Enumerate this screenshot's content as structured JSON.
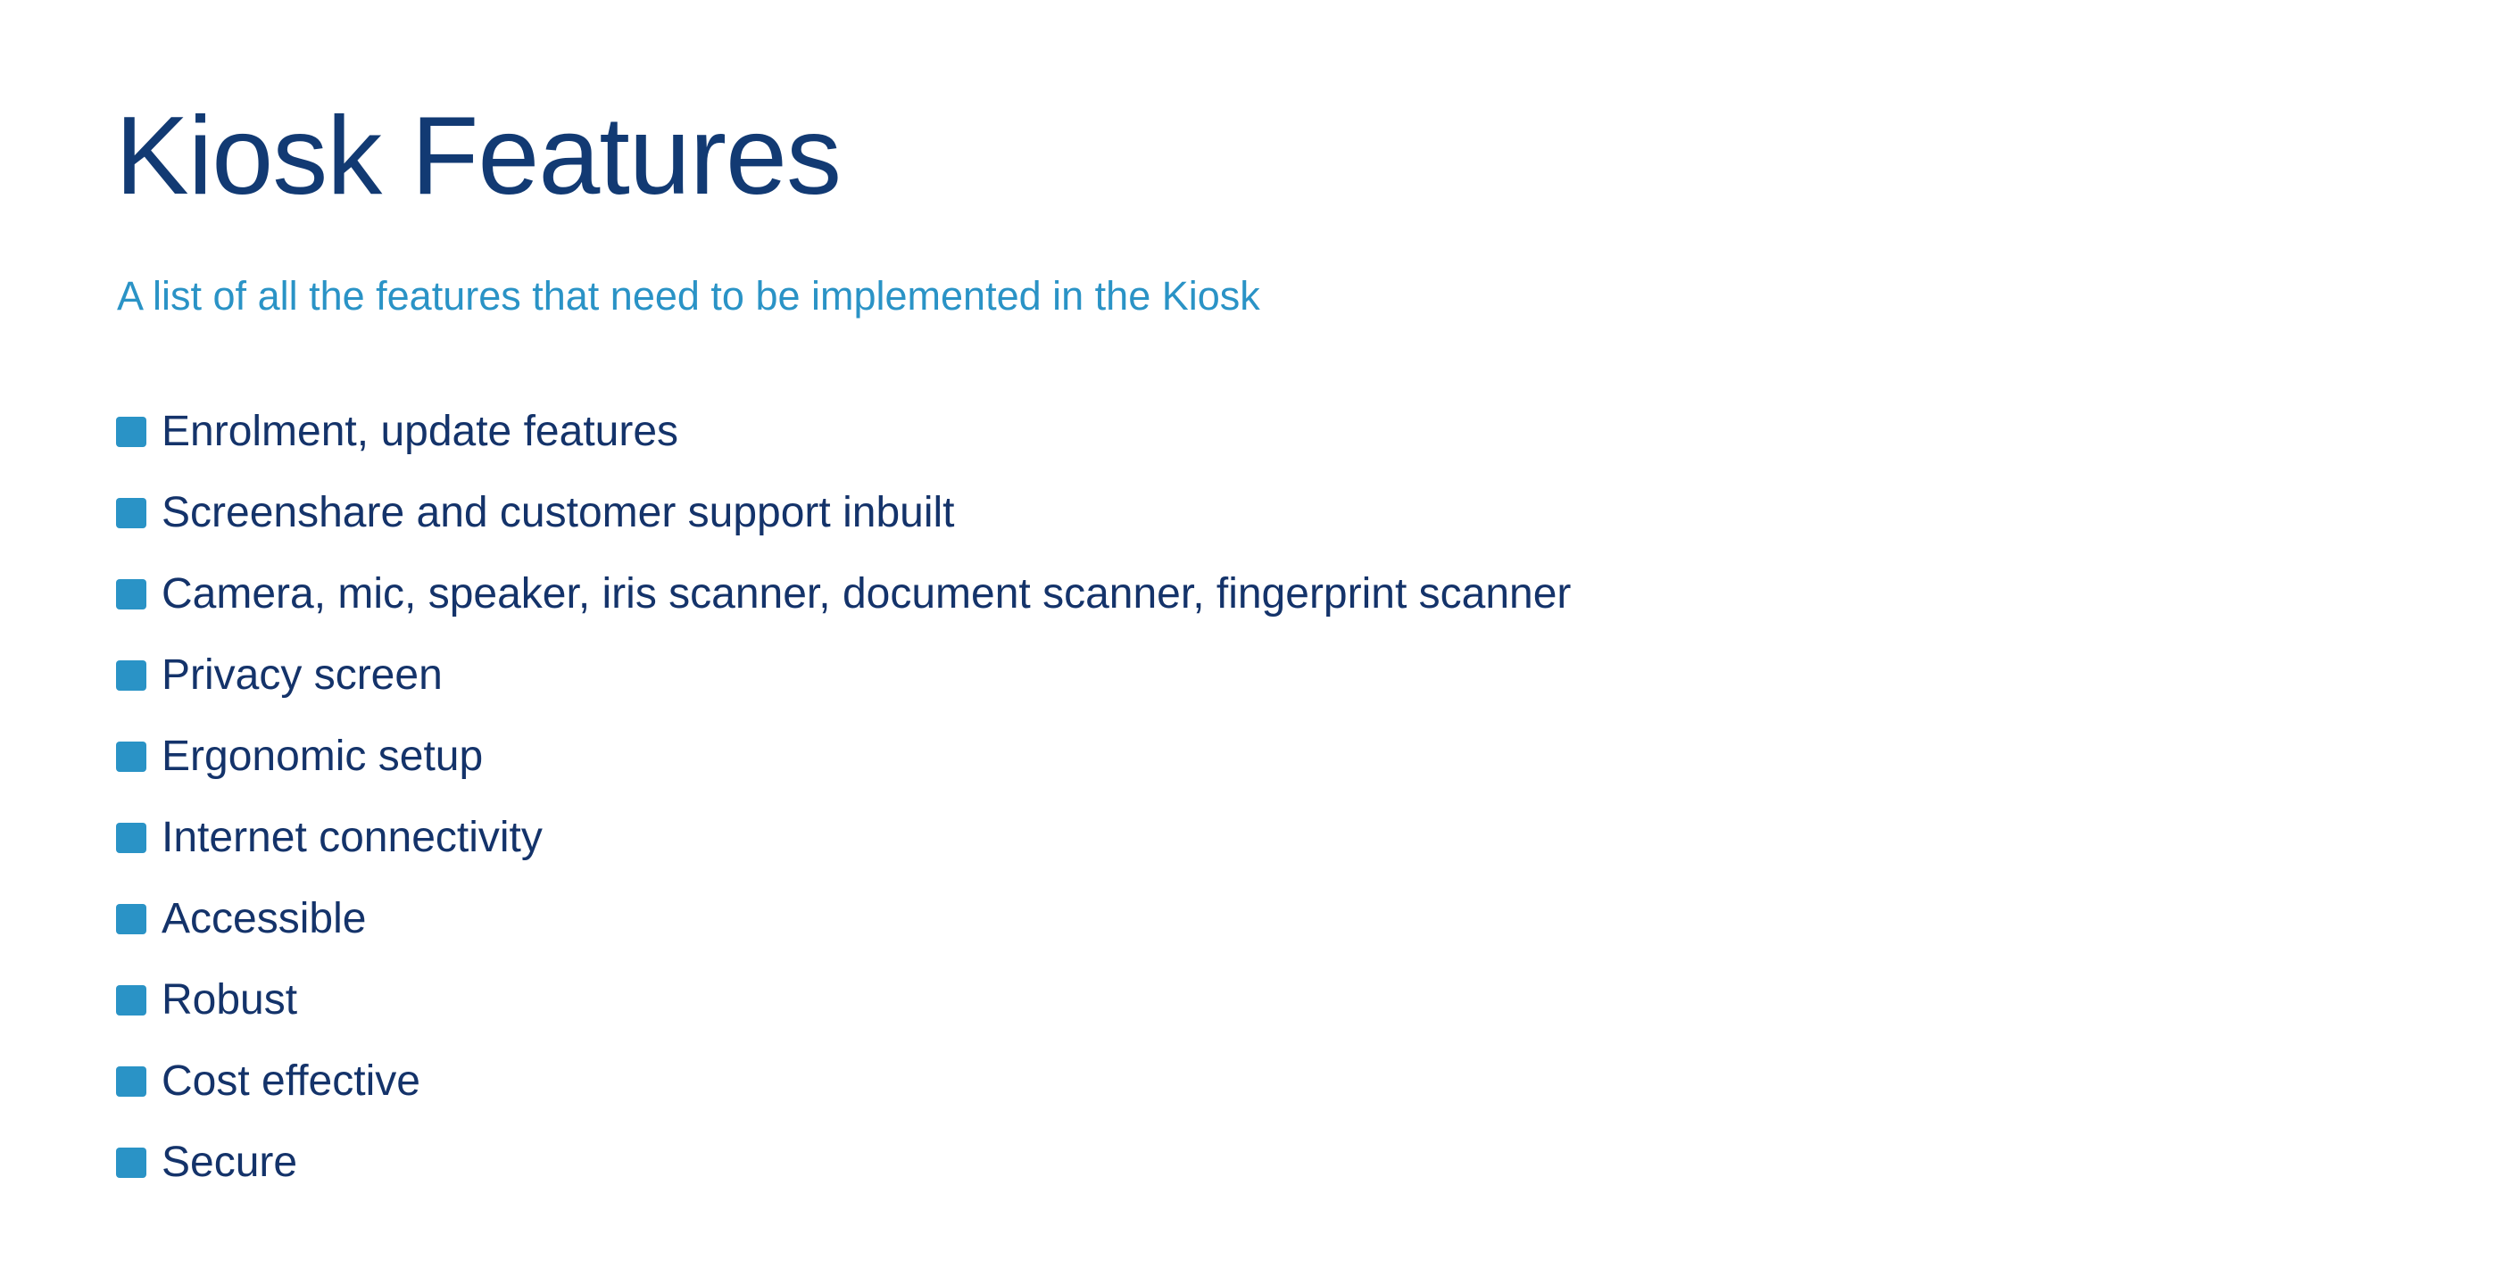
{
  "slide": {
    "title": "Kiosk Features",
    "subtitle": "A list of all the features that need to be implemented in the Kiosk",
    "bullet_icon": "square-bullet-icon",
    "colors": {
      "title": "#123a73",
      "subtitle": "#2a93c6",
      "bullet": "#2a93c6",
      "text": "#14336a",
      "background": "#ffffff"
    },
    "features": [
      "Enrolment, update features",
      "Screenshare and customer support inbuilt",
      "Camera, mic, speaker, iris scanner, document scanner, fingerprint scanner",
      "Privacy screen",
      "Ergonomic setup",
      "Internet connectivity",
      "Accessible",
      "Robust",
      "Cost effective",
      "Secure"
    ]
  }
}
